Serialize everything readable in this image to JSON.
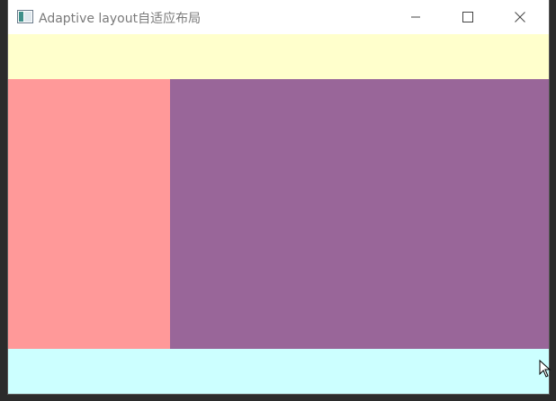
{
  "window": {
    "title": "Adaptive layout自适应布局",
    "icon": "app-window-icon",
    "controls": {
      "minimize": "minimize-icon",
      "maximize": "maximize-icon",
      "close": "close-icon"
    }
  },
  "layout": {
    "header_color": "#ffffcc",
    "sidebar_color": "#ff9999",
    "content_color": "#996699",
    "footer_color": "#ccffff"
  }
}
